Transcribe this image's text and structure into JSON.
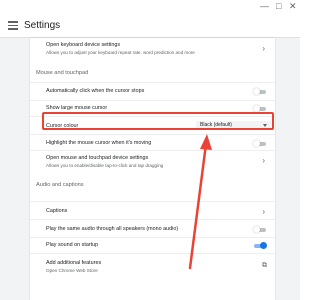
{
  "header": {
    "title": "Settings"
  },
  "keyboard": {
    "label": "Open keyboard device settings",
    "sublabel": "Allows you to adjust your keyboard repeat rate, word prediction and more"
  },
  "mouse_section": {
    "title": "Mouse and touchpad"
  },
  "mouse_items": {
    "auto_click": "Automatically click when the cursor stops",
    "large_cursor": "Show large mouse cursor",
    "cursor_colour_label": "Cursor colour",
    "cursor_colour_value": "Black (default)",
    "highlight_cursor": "Highlight the mouse cursor when it's moving",
    "mouse_settings_label": "Open mouse and touchpad device settings",
    "mouse_settings_sublabel": "Allows you to enable/disable tap-to-click and tap dragging"
  },
  "audio_section": {
    "title": "Audio and captions"
  },
  "audio_items": {
    "captions": "Captions",
    "mono_audio": "Play the same audio through all speakers (mono audio)",
    "startup_sound": "Play sound on startup",
    "additional_label": "Add additional features",
    "additional_sublabel": "Open Chrome Web Store"
  },
  "toggles": {
    "auto_click": false,
    "large_cursor": false,
    "highlight_cursor": false,
    "mono_audio": false,
    "startup_sound": true
  },
  "colors": {
    "accent": "#1a73e8",
    "annotation": "#ea4335"
  }
}
